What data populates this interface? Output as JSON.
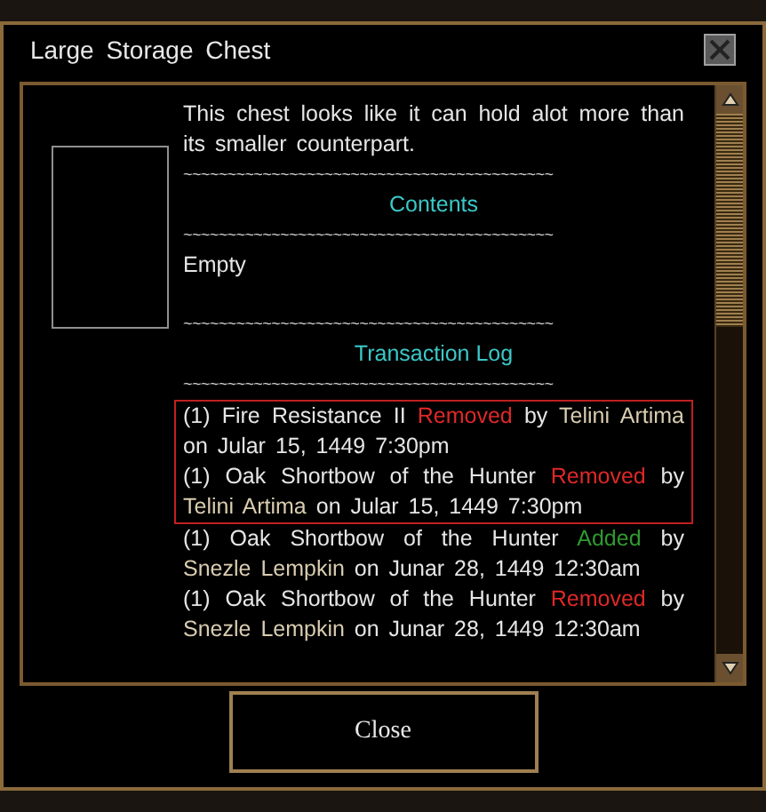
{
  "window": {
    "title": "Large Storage Chest"
  },
  "blocks": [
    {
      "kind": "text",
      "text": "This chest looks like it can hold alot more than its smaller counterpart."
    },
    {
      "kind": "divider",
      "text": "~~~~~~~~~~~~~~~~~~~~~~~~~~~~~~~~~~~~~~~~~~"
    },
    {
      "kind": "heading",
      "text": "Contents"
    },
    {
      "kind": "divider",
      "text": "~~~~~~~~~~~~~~~~~~~~~~~~~~~~~~~~~~~~~~~~~~"
    },
    {
      "kind": "text",
      "text": "Empty"
    },
    {
      "kind": "spacer"
    },
    {
      "kind": "divider",
      "text": "~~~~~~~~~~~~~~~~~~~~~~~~~~~~~~~~~~~~~~~~~~"
    },
    {
      "kind": "heading",
      "text": "Transaction Log"
    },
    {
      "kind": "divider",
      "text": "~~~~~~~~~~~~~~~~~~~~~~~~~~~~~~~~~~~~~~~~~~"
    }
  ],
  "log_entries": [
    {
      "highlighted": true,
      "segments": [
        {
          "kind": "plain",
          "text": "(1) Fire Resistance II "
        },
        {
          "kind": "removed",
          "text": "Removed"
        },
        {
          "kind": "plain",
          "text": " by "
        },
        {
          "kind": "name",
          "text": "Telini Artima"
        },
        {
          "kind": "plain",
          "text": " on Jular 15, 1449 7:30pm"
        }
      ]
    },
    {
      "highlighted": true,
      "segments": [
        {
          "kind": "plain",
          "text": "(1) Oak Shortbow of the Hunter "
        },
        {
          "kind": "removed",
          "text": "Removed"
        },
        {
          "kind": "plain",
          "text": " by "
        },
        {
          "kind": "name",
          "text": "Telini Artima"
        },
        {
          "kind": "plain",
          "text": " on Jular 15, 1449 7:30pm"
        }
      ]
    },
    {
      "highlighted": false,
      "segments": [
        {
          "kind": "plain",
          "text": "(1) Oak Shortbow of the Hunter "
        },
        {
          "kind": "added",
          "text": "Added"
        },
        {
          "kind": "plain",
          "text": " by "
        },
        {
          "kind": "name",
          "text": "Snezle Lempkin"
        },
        {
          "kind": "plain",
          "text": " on Junar 28, 1449 12:30am"
        }
      ]
    },
    {
      "highlighted": false,
      "segments": [
        {
          "kind": "plain",
          "text": "(1) Oak Shortbow of the Hunter "
        },
        {
          "kind": "removed",
          "text": "Removed"
        },
        {
          "kind": "plain",
          "text": " by "
        },
        {
          "kind": "name",
          "text": "Snezle Lempkin"
        },
        {
          "kind": "plain",
          "text": " on Junar 28, 1449 12:30am"
        }
      ]
    }
  ],
  "buttons": [
    {
      "label": "Close"
    }
  ]
}
